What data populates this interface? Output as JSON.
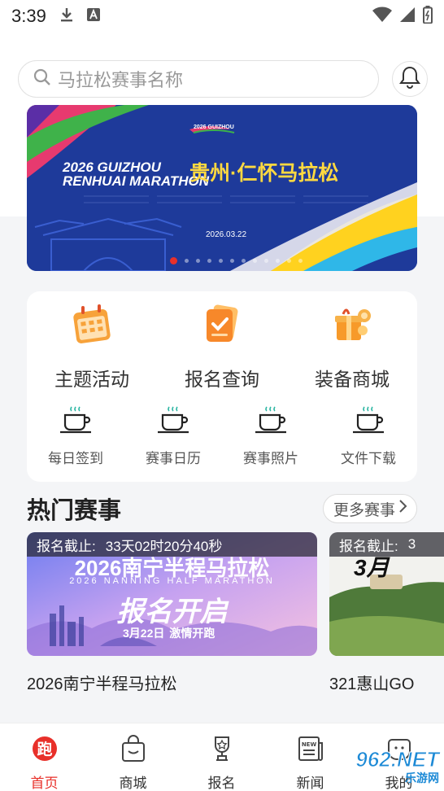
{
  "status_bar": {
    "time": "3:39"
  },
  "search": {
    "placeholder": "马拉松赛事名称"
  },
  "banner": {
    "title_en_line1": "2026 GUIZHOU",
    "title_en_line2": "RENHUAI MARATHON",
    "title_cn": "贵州·仁怀马拉松",
    "date": "2026.03.22",
    "logo_text": "2026 GUIZHOU",
    "slide_count": 12,
    "active_slide": 0
  },
  "quick_menu": {
    "big_items": [
      {
        "label": "主题活动",
        "icon": "calendar-icon"
      },
      {
        "label": "报名查询",
        "icon": "clipboard-check-icon"
      },
      {
        "label": "装备商城",
        "icon": "gift-box-icon"
      }
    ],
    "small_items": [
      {
        "label": "每日签到",
        "icon": "coffee-cup-icon"
      },
      {
        "label": "赛事日历",
        "icon": "coffee-cup-icon"
      },
      {
        "label": "赛事照片",
        "icon": "coffee-cup-icon"
      },
      {
        "label": "文件下载",
        "icon": "coffee-cup-icon"
      }
    ]
  },
  "hot_events": {
    "title": "热门赛事",
    "more_label": "更多赛事",
    "items": [
      {
        "deadline_label": "报名截止:",
        "deadline_value": "33天02时20分40秒",
        "poster_title": "2026南宁半程马拉松",
        "poster_subtitle": "2026 NANNING HALF MARATHON",
        "poster_slogan": "报名开启",
        "poster_date": "3月22日",
        "poster_tagline": "激情开跑",
        "name": "2026南宁半程马拉松"
      },
      {
        "deadline_label": "报名截止:",
        "deadline_value": "3",
        "poster_title": "3月",
        "name": "321惠山GO"
      }
    ]
  },
  "tabbar": {
    "items": [
      {
        "label": "首页",
        "icon": "home-run-icon",
        "active": true
      },
      {
        "label": "商城",
        "icon": "shopping-bag-icon",
        "active": false
      },
      {
        "label": "报名",
        "icon": "trophy-icon",
        "active": false
      },
      {
        "label": "新闻",
        "icon": "news-icon",
        "active": false
      },
      {
        "label": "我的",
        "icon": "user-icon",
        "active": false
      }
    ]
  },
  "watermark": {
    "main": "962.NET",
    "sub": "乐游网"
  },
  "colors": {
    "accent": "#e8302a",
    "banner_bg": "#1e3a9a",
    "link_blue": "#1d8ad6"
  }
}
